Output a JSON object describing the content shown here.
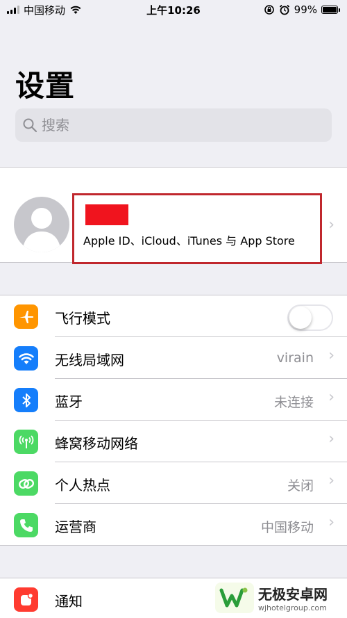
{
  "status": {
    "carrier": "中国移动",
    "time": "上午10:26",
    "battery": "99%",
    "battery_level": 0.99
  },
  "page": {
    "title": "设置"
  },
  "search": {
    "placeholder": "搜索"
  },
  "profile": {
    "subtitle": "Apple ID、iCloud、iTunes 与 App Store"
  },
  "settings": [
    {
      "label": "飞行模式",
      "value": "",
      "icon": "airplane-icon",
      "color": "#ff9500",
      "toggle_on": false
    },
    {
      "label": "无线局域网",
      "value": "virain",
      "icon": "wifi-icon",
      "color": "#157efb"
    },
    {
      "label": "蓝牙",
      "value": "未连接",
      "icon": "bluetooth-icon",
      "color": "#157efb"
    },
    {
      "label": "蜂窝移动网络",
      "value": "",
      "icon": "cellular-icon",
      "color": "#4cd964"
    },
    {
      "label": "个人热点",
      "value": "关闭",
      "icon": "hotspot-icon",
      "color": "#4cd964"
    },
    {
      "label": "运营商",
      "value": "中国移动",
      "icon": "phone-icon",
      "color": "#4cd964"
    }
  ],
  "notifications": {
    "label": "通知",
    "icon": "notifications-icon",
    "color": "#ff3b30"
  },
  "watermark": {
    "title": "无极安卓网",
    "url": "wjhotelgroup.com"
  }
}
